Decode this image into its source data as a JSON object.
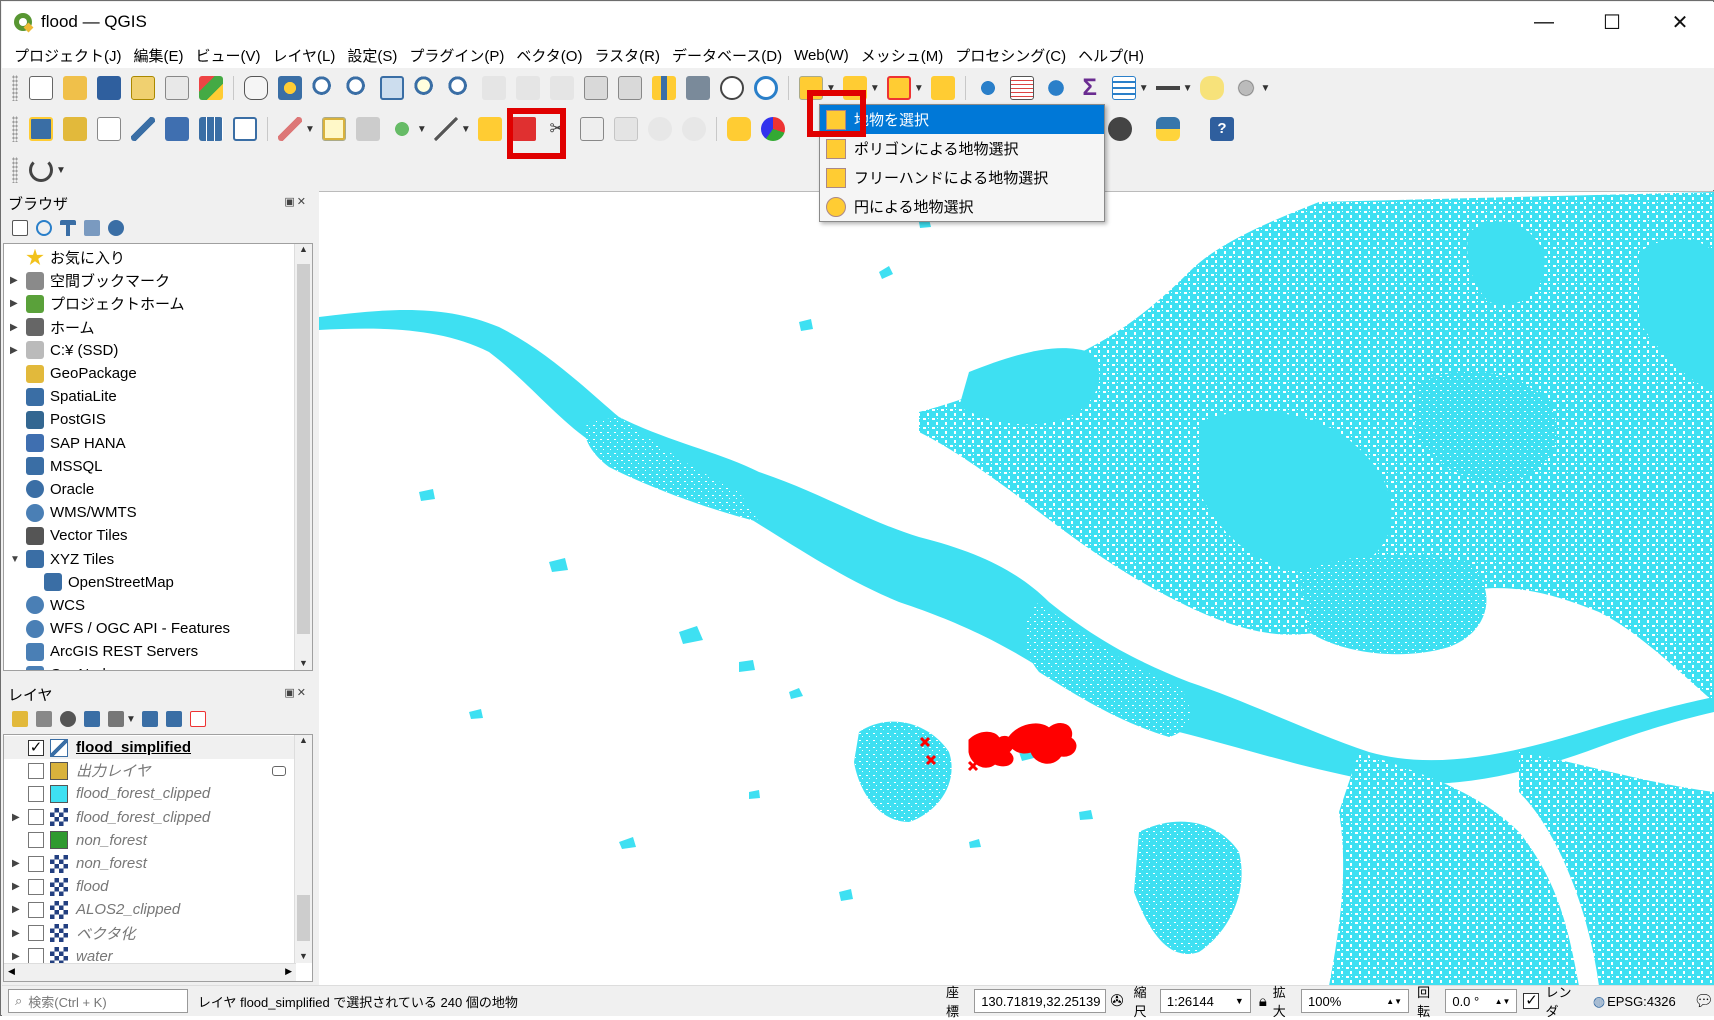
{
  "window": {
    "title": "flood — QGIS",
    "minimize": "—",
    "maximize": "☐",
    "close": "✕"
  },
  "menu": [
    "プロジェクト(J)",
    "編集(E)",
    "ビュー(V)",
    "レイヤ(L)",
    "設定(S)",
    "プラグイン(P)",
    "ベクタ(O)",
    "ラスタ(R)",
    "データベース(D)",
    "Web(W)",
    "メッシュ(M)",
    "プロセシング(C)",
    "ヘルプ(H)"
  ],
  "browser": {
    "title": "ブラウザ",
    "items": [
      {
        "label": "お気に入り",
        "icon": "star-icon",
        "arrow": "",
        "color": "#f2c21b"
      },
      {
        "label": "空間ブックマーク",
        "icon": "bookmark-icon",
        "arrow": "▶",
        "color": "#8a8a8a"
      },
      {
        "label": "プロジェクトホーム",
        "icon": "project-home-icon",
        "arrow": "▶",
        "color": "#5aa13a"
      },
      {
        "label": "ホーム",
        "icon": "home-icon",
        "arrow": "▶",
        "color": "#666"
      },
      {
        "label": "C:¥ (SSD)",
        "icon": "folder-icon",
        "arrow": "▶",
        "color": "#bbb"
      },
      {
        "label": "GeoPackage",
        "icon": "geopackage-icon",
        "arrow": "",
        "color": "#e2b93b"
      },
      {
        "label": "SpatiaLite",
        "icon": "spatialite-icon",
        "arrow": "",
        "color": "#3a6ea5"
      },
      {
        "label": "PostGIS",
        "icon": "postgis-icon",
        "arrow": "",
        "color": "#336791"
      },
      {
        "label": "SAP HANA",
        "icon": "sap-hana-icon",
        "arrow": "",
        "color": "#3f6fb0"
      },
      {
        "label": "MSSQL",
        "icon": "mssql-icon",
        "arrow": "",
        "color": "#3a6ea5"
      },
      {
        "label": "Oracle",
        "icon": "oracle-icon",
        "arrow": "",
        "color": "#3a6ea5"
      },
      {
        "label": "WMS/WMTS",
        "icon": "globe-icon",
        "arrow": "",
        "color": "#4a7fb5"
      },
      {
        "label": "Vector Tiles",
        "icon": "vector-tiles-icon",
        "arrow": "",
        "color": "#555"
      },
      {
        "label": "XYZ Tiles",
        "icon": "xyz-tiles-icon",
        "arrow": "▼",
        "color": "#3a6ea5"
      },
      {
        "label": "OpenStreetMap",
        "icon": "tiles-grid-icon",
        "arrow": "",
        "color": "#3a6ea5",
        "indent": true
      },
      {
        "label": "WCS",
        "icon": "globe-icon",
        "arrow": "",
        "color": "#4a7fb5"
      },
      {
        "label": "WFS / OGC API - Features",
        "icon": "globe-icon",
        "arrow": "",
        "color": "#4a7fb5"
      },
      {
        "label": "ArcGIS REST Servers",
        "icon": "arcgis-icon",
        "arrow": "",
        "color": "#4a7fb5"
      },
      {
        "label": "GeoNode",
        "icon": "geonode-icon",
        "arrow": "",
        "color": "#4a7fb5"
      }
    ]
  },
  "layers": {
    "title": "レイヤ",
    "items": [
      {
        "label": "flood_simplified",
        "checked": true,
        "arrow": "",
        "swatch": "#5ec6e8",
        "active": true,
        "type": "vector"
      },
      {
        "label": "出力レイヤ",
        "checked": false,
        "arrow": "",
        "swatch": "#d9b23c",
        "type": "fill"
      },
      {
        "label": "flood_forest_clipped",
        "checked": false,
        "arrow": "",
        "swatch": "#3ee0f2",
        "type": "fill"
      },
      {
        "label": "flood_forest_clipped",
        "checked": false,
        "arrow": "▶",
        "swatch": "#223f80",
        "type": "raster"
      },
      {
        "label": "non_forest",
        "checked": false,
        "arrow": "",
        "swatch": "#2f9a2f",
        "type": "fill"
      },
      {
        "label": "non_forest",
        "checked": false,
        "arrow": "▶",
        "swatch": "#223f80",
        "type": "raster"
      },
      {
        "label": "flood",
        "checked": false,
        "arrow": "▶",
        "swatch": "#223f80",
        "type": "raster"
      },
      {
        "label": "ALOS2_clipped",
        "checked": false,
        "arrow": "▶",
        "swatch": "#223f80",
        "type": "raster"
      },
      {
        "label": "ベクタ化",
        "checked": false,
        "arrow": "▶",
        "swatch": "#223f80",
        "type": "raster"
      },
      {
        "label": "water",
        "checked": false,
        "arrow": "▶",
        "swatch": "#223f80",
        "type": "raster"
      }
    ]
  },
  "select_menu": {
    "items": [
      "地物を選択",
      "ポリゴンによる地物選択",
      "フリーハンドによる地物選択",
      "円による地物選択"
    ]
  },
  "status": {
    "search_placeholder": "検索(Ctrl + K)",
    "message": "レイヤ flood_simplified で選択されている 240 個の地物",
    "coord_label": "座標",
    "coord_value": "130.71819,32.25139",
    "scale_label": "縮尺",
    "scale_value": "1:26144",
    "magnifier_label": "拡大",
    "magnifier_value": "100%",
    "rotation_label": "回転",
    "rotation_value": "0.0 °",
    "render_label": "レンダ",
    "crs": "EPSG:4326"
  },
  "colors": {
    "flood": "#3ee0f2",
    "selection": "#ff0000",
    "highlight": "#e00000"
  }
}
